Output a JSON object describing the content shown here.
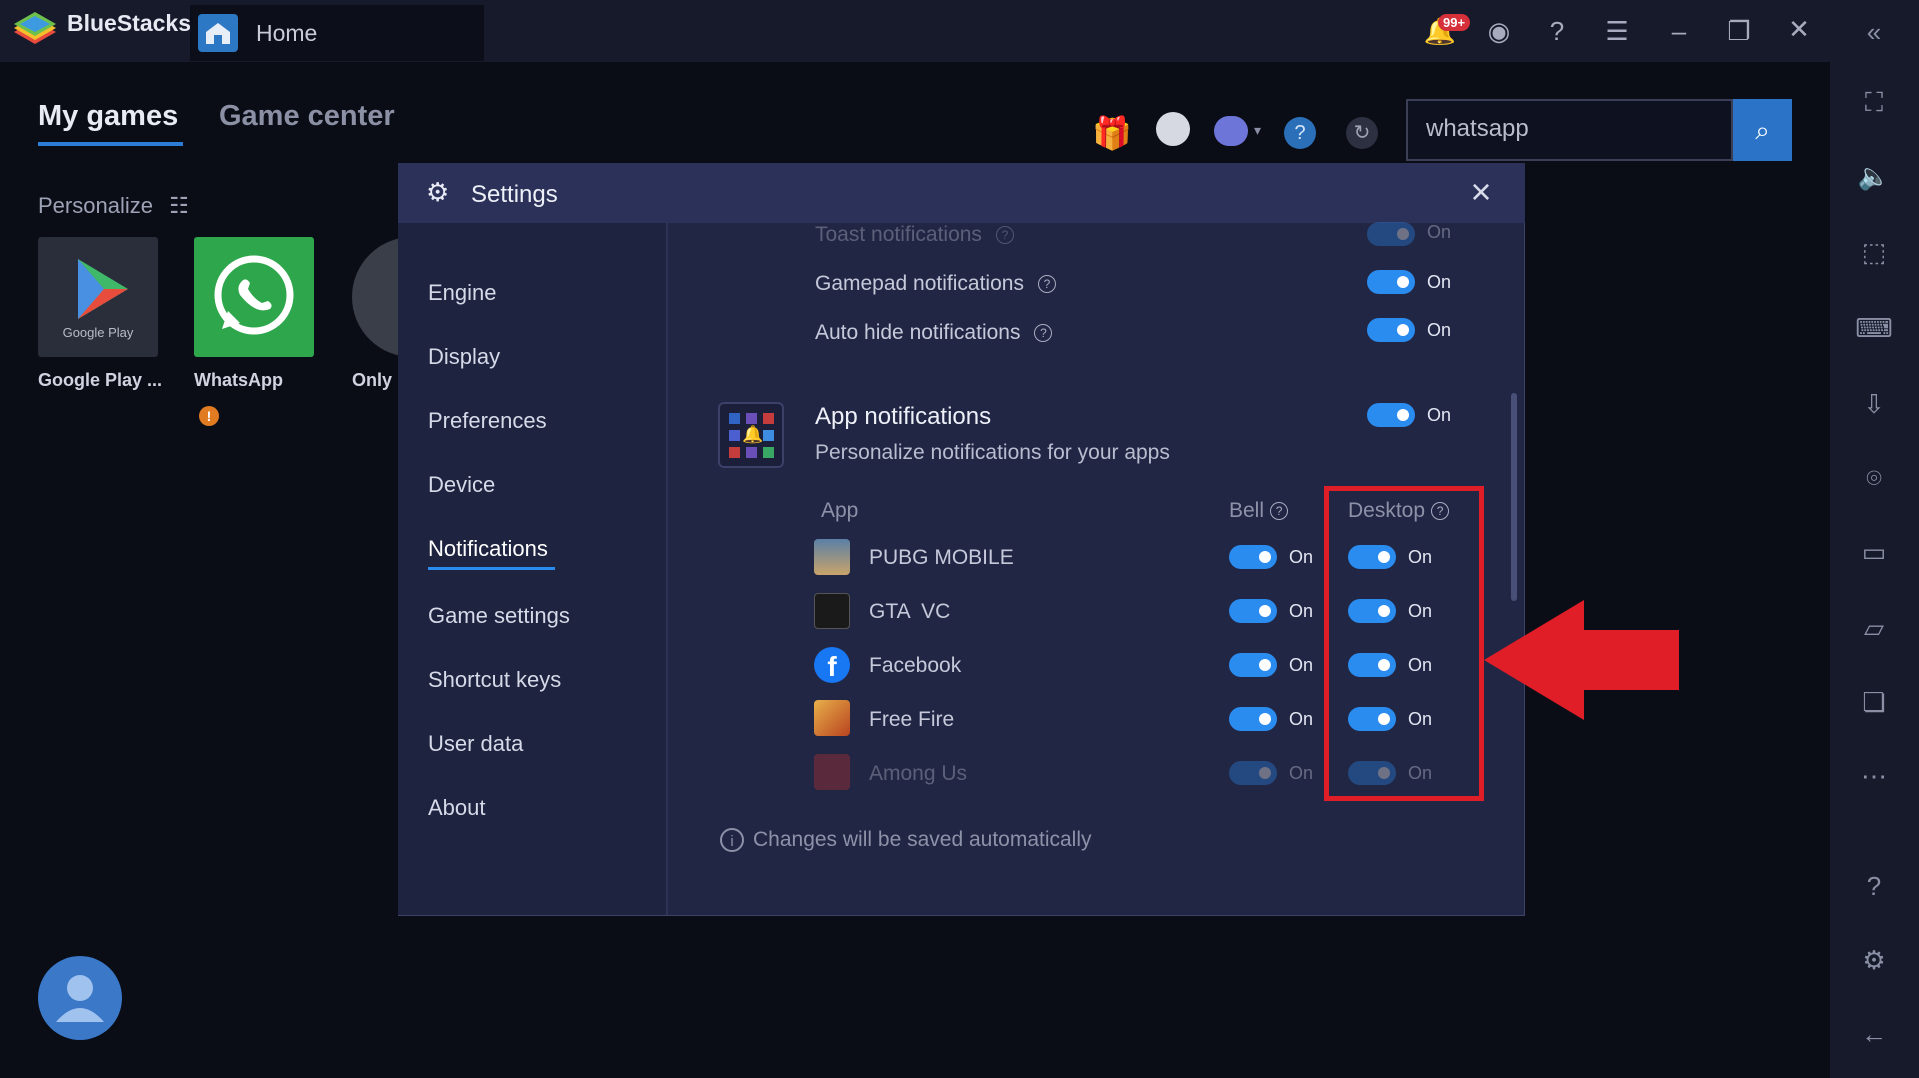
{
  "app": {
    "brand": "BlueStacks",
    "tab_label": "Home",
    "notification_badge": "99+"
  },
  "home": {
    "nav_tabs": [
      "My games",
      "Game center"
    ],
    "personalize_label": "Personalize",
    "apps": [
      {
        "label": "Google Play ...",
        "inner_text": "Google Play"
      },
      {
        "label": "WhatsApp"
      },
      {
        "label": "Only"
      }
    ],
    "search": {
      "value": "whatsapp"
    }
  },
  "settings": {
    "title": "Settings",
    "menu": [
      "Engine",
      "Display",
      "Preferences",
      "Device",
      "Notifications",
      "Game settings",
      "Shortcut keys",
      "User data",
      "About"
    ],
    "active_menu": "Notifications",
    "rows": [
      {
        "label": "Toast notifications",
        "state": "On"
      },
      {
        "label": "Gamepad notifications",
        "state": "On"
      },
      {
        "label": "Auto hide notifications",
        "state": "On"
      }
    ],
    "app_notifications": {
      "title": "App notifications",
      "subtitle": "Personalize notifications for your apps",
      "state": "On",
      "columns": {
        "app": "App",
        "bell": "Bell",
        "desktop": "Desktop"
      },
      "apps": [
        {
          "name": "PUBG MOBILE",
          "bell": "On",
          "desktop": "On"
        },
        {
          "name": "GTA  VC",
          "bell": "On",
          "desktop": "On"
        },
        {
          "name": "Facebook",
          "bell": "On",
          "desktop": "On"
        },
        {
          "name": "Free Fire",
          "bell": "On",
          "desktop": "On"
        },
        {
          "name": "Among Us",
          "bell": "On",
          "desktop": "On"
        }
      ]
    },
    "footer": "Changes will be saved automatically"
  },
  "colors": {
    "accent": "#2b8cf0",
    "annotation": "#e01e27",
    "dialog_bg": "#212644"
  }
}
